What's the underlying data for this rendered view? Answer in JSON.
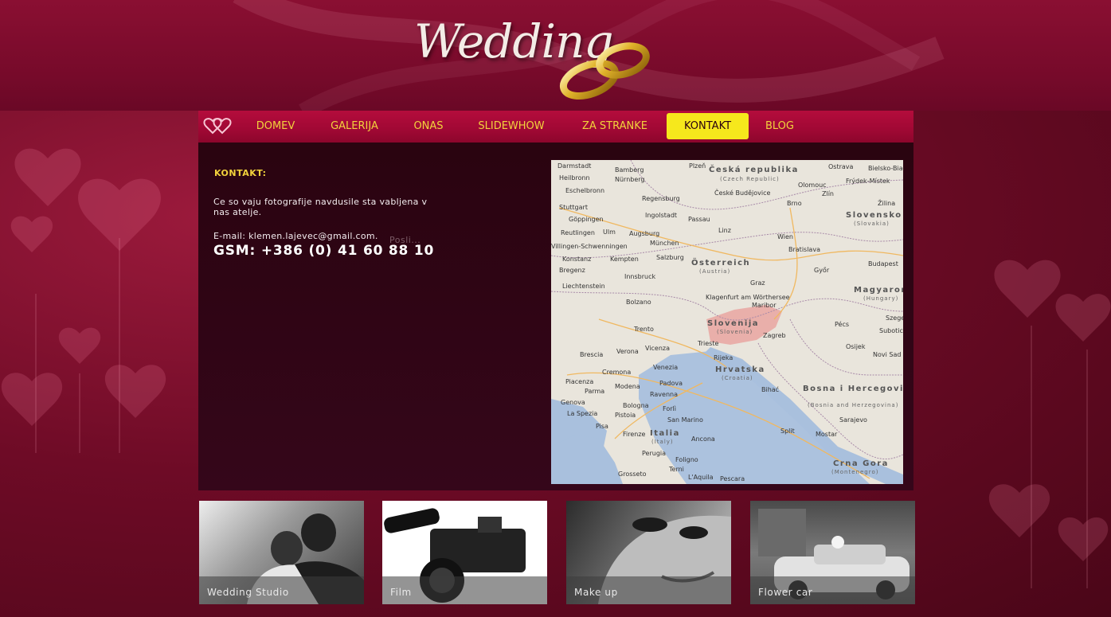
{
  "header": {
    "logo_text": "Wedding"
  },
  "nav": {
    "items": [
      {
        "label": "DOMEV",
        "active": false
      },
      {
        "label": "GALERIJA",
        "active": false
      },
      {
        "label": "ONAS",
        "active": false
      },
      {
        "label": "SLIDEWHOW",
        "active": false
      },
      {
        "label": "ZA STRANKE",
        "active": false
      },
      {
        "label": "KONTAKT",
        "active": true
      },
      {
        "label": "BLOG",
        "active": false
      }
    ]
  },
  "contact": {
    "title": "KONTAKT:",
    "text": "Ce so vaju fotografije navdusile sta vabljena v nas atelje.",
    "email": "E-mail: klemen.lajevec@gmail.com.",
    "send_label": "Posli...",
    "gsm": "GSM: +386 (0) 41 60 88 10"
  },
  "map": {
    "labels": [
      {
        "text": "Darmstadt"
      },
      {
        "text": "Bamberg"
      },
      {
        "text": "Nürnberg"
      },
      {
        "text": "Plzeň"
      },
      {
        "text": "Česká republika"
      },
      {
        "text": "(Czech Republic)"
      },
      {
        "text": "Ostrava"
      },
      {
        "text": "Bielsko-Biała"
      },
      {
        "text": "Frýdek-Místek"
      },
      {
        "text": "Heilbronn"
      },
      {
        "text": "Olomouc"
      },
      {
        "text": "Eschelbronn"
      },
      {
        "text": "Regensburg"
      },
      {
        "text": "České Budějovice"
      },
      {
        "text": "Zlín"
      },
      {
        "text": "Stuttgart"
      },
      {
        "text": "Ingolstadt"
      },
      {
        "text": "Brno"
      },
      {
        "text": "Žilina"
      },
      {
        "text": "Göppingen"
      },
      {
        "text": "Passau"
      },
      {
        "text": "Slovensko"
      },
      {
        "text": "(Slovakia)"
      },
      {
        "text": "Reutlingen"
      },
      {
        "text": "Ulm"
      },
      {
        "text": "Augsburg"
      },
      {
        "text": "Linz"
      },
      {
        "text": "Villingen-Schwenningen"
      },
      {
        "text": "München"
      },
      {
        "text": "Wien"
      },
      {
        "text": "Bratislava"
      },
      {
        "text": "Salzburg"
      },
      {
        "text": "Österreich"
      },
      {
        "text": "(Austria)"
      },
      {
        "text": "Konstanz"
      },
      {
        "text": "Kempten"
      },
      {
        "text": "Budapest"
      },
      {
        "text": "Bregenz"
      },
      {
        "text": "Innsbruck"
      },
      {
        "text": "Győr"
      },
      {
        "text": "Liechtenstein"
      },
      {
        "text": "Magyarország"
      },
      {
        "text": "(Hungary)"
      },
      {
        "text": "Graz"
      },
      {
        "text": "Bolzano"
      },
      {
        "text": "Klagenfurt am Wörthersee"
      },
      {
        "text": "Maribor"
      },
      {
        "text": "Szeged"
      },
      {
        "text": "Trento"
      },
      {
        "text": "Slovenija"
      },
      {
        "text": "(Slovenia)"
      },
      {
        "text": "Pécs"
      },
      {
        "text": "Subotica"
      },
      {
        "text": "Zagreb"
      },
      {
        "text": "Brescia"
      },
      {
        "text": "Verona"
      },
      {
        "text": "Vicenza"
      },
      {
        "text": "Trieste"
      },
      {
        "text": "Osijek"
      },
      {
        "text": "Novi Sad"
      },
      {
        "text": "Venezia"
      },
      {
        "text": "Cremona"
      },
      {
        "text": "Hrvatska"
      },
      {
        "text": "(Croatia)"
      },
      {
        "text": "Piacenza"
      },
      {
        "text": "Padova"
      },
      {
        "text": "Rijeka"
      },
      {
        "text": "Parma"
      },
      {
        "text": "Modena"
      },
      {
        "text": "Ravenna"
      },
      {
        "text": "Bihać"
      },
      {
        "text": "Bosna i Hercegovina"
      },
      {
        "text": "(Bosnia and Herzegovina)"
      },
      {
        "text": "Genova"
      },
      {
        "text": "Bologna"
      },
      {
        "text": "Forlì"
      },
      {
        "text": "La Spezia"
      },
      {
        "text": "Pistoia"
      },
      {
        "text": "San Marino"
      },
      {
        "text": "Sarajevo"
      },
      {
        "text": "Pisa"
      },
      {
        "text": "Firenze"
      },
      {
        "text": "Italia"
      },
      {
        "text": "(Italy)"
      },
      {
        "text": "Split"
      },
      {
        "text": "Ancona"
      },
      {
        "text": "Mostar"
      },
      {
        "text": "Perugia"
      },
      {
        "text": "Foligno"
      },
      {
        "text": "Crna Gora"
      },
      {
        "text": "(Montenegro)"
      },
      {
        "text": "Grosseto"
      },
      {
        "text": "Terni"
      },
      {
        "text": "L'Aquila"
      },
      {
        "text": "Pescara"
      }
    ]
  },
  "tiles": [
    {
      "label": "Wedding Studio"
    },
    {
      "label": "Film"
    },
    {
      "label": "Make up"
    },
    {
      "label": "Flower car"
    }
  ],
  "colors": {
    "accent_yellow": "#f2d23c",
    "active_tab": "#f6e81c",
    "nav_red": "#a00834",
    "panel_dark": "#2a0410"
  }
}
